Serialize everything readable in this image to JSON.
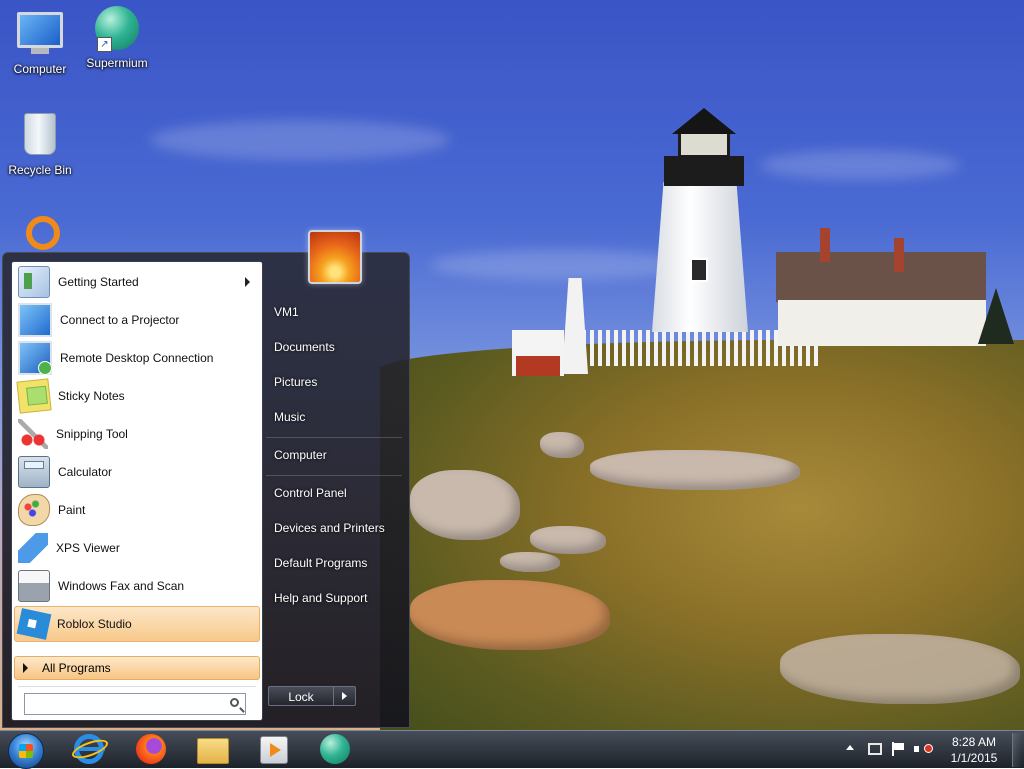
{
  "desktop": {
    "icons": [
      {
        "label": "Computer"
      },
      {
        "label": "Supermium"
      },
      {
        "label": "Recycle Bin"
      }
    ]
  },
  "start_menu": {
    "programs": [
      {
        "label": "Getting Started",
        "icon": "getting-started-icon",
        "has_submenu": true
      },
      {
        "label": "Connect to a Projector",
        "icon": "projector-icon"
      },
      {
        "label": "Remote Desktop Connection",
        "icon": "remote-desktop-icon"
      },
      {
        "label": "Sticky Notes",
        "icon": "sticky-notes-icon"
      },
      {
        "label": "Snipping Tool",
        "icon": "snipping-tool-icon"
      },
      {
        "label": "Calculator",
        "icon": "calculator-icon"
      },
      {
        "label": "Paint",
        "icon": "paint-icon"
      },
      {
        "label": "XPS Viewer",
        "icon": "xps-viewer-icon"
      },
      {
        "label": "Windows Fax and Scan",
        "icon": "fax-scan-icon"
      },
      {
        "label": "Roblox Studio",
        "icon": "roblox-studio-icon",
        "highlighted": true
      }
    ],
    "all_programs_label": "All Programs",
    "search_placeholder": "",
    "right_items": [
      {
        "label": "VM1"
      },
      {
        "label": "Documents"
      },
      {
        "label": "Pictures"
      },
      {
        "label": "Music"
      },
      {
        "label": "Computer"
      },
      {
        "label": "Control Panel"
      },
      {
        "label": "Devices and Printers"
      },
      {
        "label": "Default Programs"
      },
      {
        "label": "Help and Support"
      }
    ],
    "power_button_label": "Lock"
  },
  "taskbar": {
    "pinned": [
      "internet-explorer-icon",
      "firefox-icon",
      "file-explorer-icon",
      "media-player-icon",
      "supermium-icon"
    ],
    "clock": {
      "time": "8:28 AM",
      "date": "1/1/2015"
    }
  },
  "colors": {
    "highlight_top": "#fce7c8",
    "highlight_bottom": "#f8c98a",
    "taskbar": "#1f252e"
  }
}
